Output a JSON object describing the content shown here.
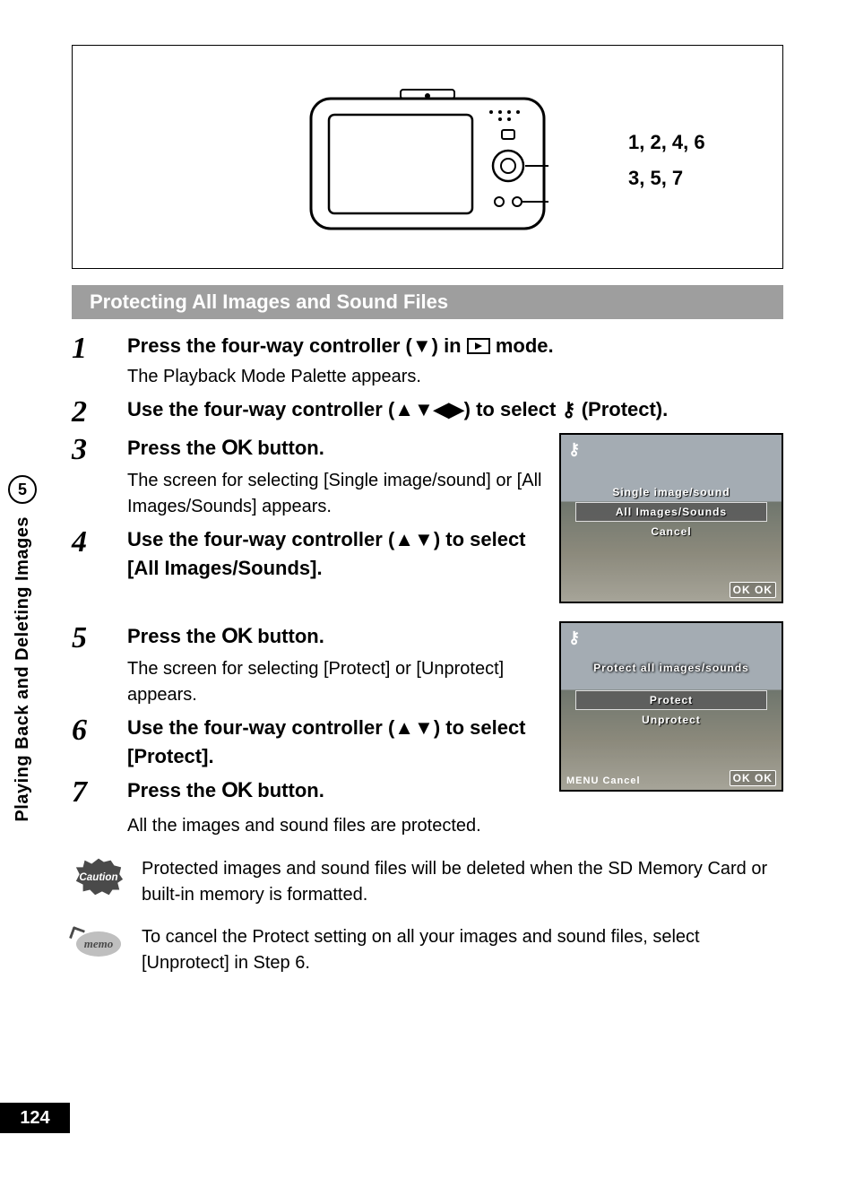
{
  "sidebar": {
    "chapter_number": "5",
    "chapter_title": "Playing Back and Deleting Images"
  },
  "page_number": "124",
  "callouts": {
    "top": "1, 2, 4, 6",
    "bottom": "3, 5, 7"
  },
  "section_title": "Protecting All Images and Sound Files",
  "steps": [
    {
      "num": "1",
      "head_pre": "Press the four-way controller (▼) in ",
      "head_post": " mode.",
      "sub": "The Playback Mode Palette appears."
    },
    {
      "num": "2",
      "head": "Use the four-way controller (▲▼◀▶) to select ⚷ (Protect).",
      "sub": ""
    },
    {
      "num": "3",
      "head_pre": "Press the ",
      "ok": "OK",
      "head_post": " button.",
      "sub": "The screen for selecting [Single image/sound] or [All Images/Sounds] appears."
    },
    {
      "num": "4",
      "head": "Use the four-way controller (▲▼) to select [All Images/Sounds].",
      "sub": ""
    },
    {
      "num": "5",
      "head_pre": "Press the ",
      "ok": "OK",
      "head_post": " button.",
      "sub": "The screen for selecting [Protect] or [Unprotect] appears."
    },
    {
      "num": "6",
      "head": "Use the four-way controller (▲▼) to select [Protect].",
      "sub": ""
    },
    {
      "num": "7",
      "head_pre": "Press the ",
      "ok": "OK",
      "head_post": " button.",
      "sub": "All the images and sound files are protected."
    }
  ],
  "screen1": {
    "rows": [
      "Single image/sound",
      "All Images/Sounds",
      "Cancel"
    ],
    "ok": "OK OK"
  },
  "screen2": {
    "title": "Protect all images/sounds",
    "rows": [
      "Protect",
      "Unprotect"
    ],
    "menu": "MENU Cancel",
    "ok": "OK OK"
  },
  "caution_text": "Protected images and sound files will be deleted when the SD Memory Card or built-in memory is formatted.",
  "memo_label": "memo",
  "memo_text": "To cancel the Protect setting on all your images and sound files, select [Unprotect] in Step 6.",
  "caution_label": "Caution"
}
